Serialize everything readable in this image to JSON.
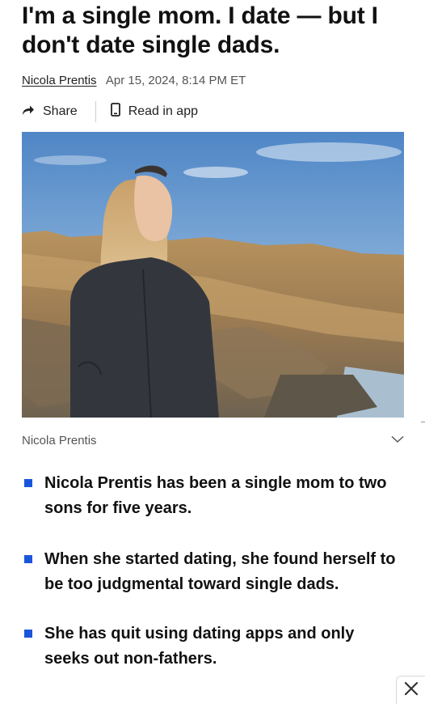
{
  "article": {
    "headline": "I'm a single mom. I date — but I don't date single dads.",
    "author": "Nicola Prentis",
    "timestamp": "Apr 15, 2024, 8:14 PM ET"
  },
  "actions": {
    "share_label": "Share",
    "read_in_app_label": "Read in app"
  },
  "image": {
    "caption": "Nicola Prentis"
  },
  "bullets": [
    "Nicola Prentis has been a single mom to two sons for five years.",
    "When she started dating, she found herself to be too judgmental toward single dads.",
    "She has quit using dating apps and only seeks out non-fathers."
  ],
  "icons": {
    "share": "share-arrow-icon",
    "phone": "phone-icon",
    "expand": "chevron-down-icon",
    "close": "close-icon"
  },
  "colors": {
    "bullet_accent": "#1a56db"
  }
}
